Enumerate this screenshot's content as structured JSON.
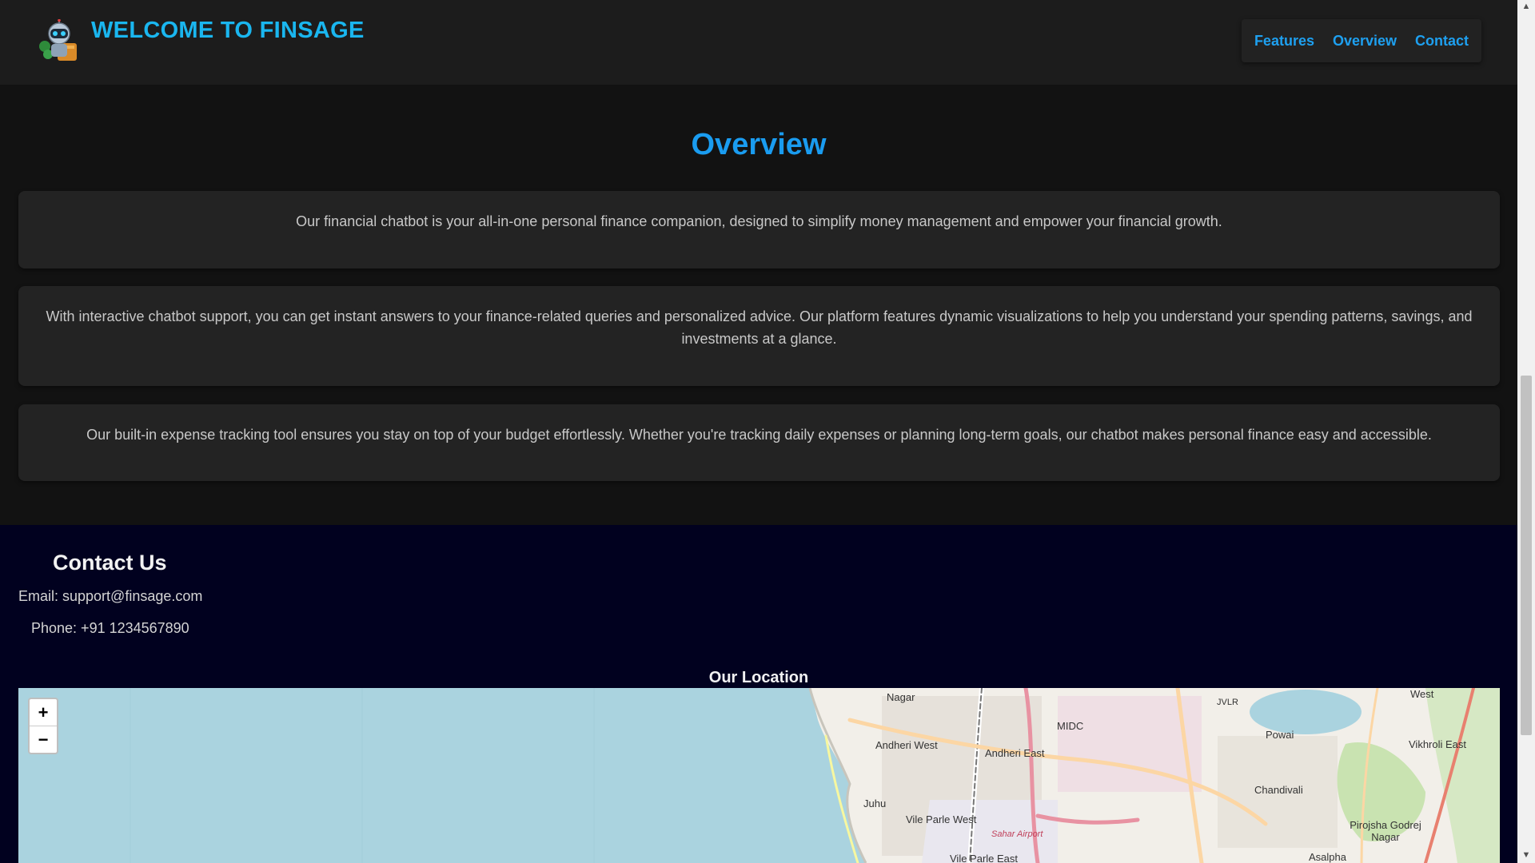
{
  "header": {
    "title": "WELCOME TO FINSAGE",
    "nav": [
      {
        "label": "Features"
      },
      {
        "label": "Overview"
      },
      {
        "label": "Contact"
      }
    ]
  },
  "overview": {
    "title": "Overview",
    "paragraphs": [
      "Our financial chatbot is your all-in-one personal finance companion, designed to simplify money management and empower your financial growth.",
      "With interactive chatbot support, you can get instant answers to your finance-related queries and personalized advice. Our platform features dynamic visualizations to help you understand your spending patterns, savings, and investments at a glance.",
      "Our built-in expense tracking tool ensures you stay on top of your budget effortlessly. Whether you're tracking daily expenses or planning long-term goals, our chatbot makes personal finance easy and accessible."
    ]
  },
  "contact": {
    "title": "Contact Us",
    "email": "Email: support@finsage.com",
    "phone": "Phone: +91 1234567890",
    "location_title": "Our Location"
  },
  "map": {
    "zoom_in": "+",
    "zoom_out": "−",
    "labels": [
      "Nagar",
      "Andheri West",
      "Andheri East",
      "MIDC",
      "JVLR",
      "Powai",
      "Vikhroli East",
      "West",
      "Chandivali",
      "Juhu",
      "Vile Parle West",
      "Sahar Airport",
      "Pirojsha Godrej Nagar",
      "Asalpha",
      "Vile Parle East"
    ]
  }
}
